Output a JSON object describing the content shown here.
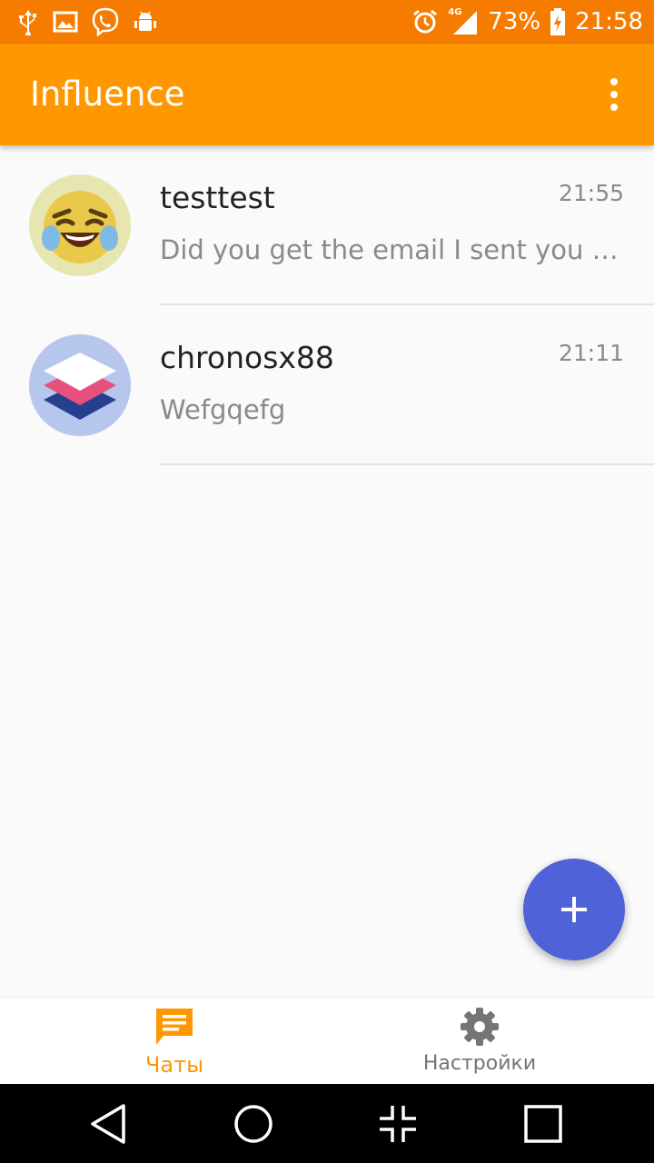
{
  "status_bar": {
    "battery": "73%",
    "time": "21:58",
    "network": "4G"
  },
  "app_bar": {
    "title": "Influence"
  },
  "chats": [
    {
      "name": "testtest",
      "time": "21:55",
      "message": "Did you get the email I sent you a t..."
    },
    {
      "name": "chronosx88",
      "time": "21:11",
      "message": "Wefgqefg"
    }
  ],
  "bottom_nav": {
    "chats_label": "Чаты",
    "settings_label": "Настройки"
  },
  "colors": {
    "status_bar": "#f57c00",
    "app_bar": "#ff9800",
    "fab": "#4f62d8",
    "active_tab": "#ff9800",
    "inactive_tab": "#757575"
  }
}
